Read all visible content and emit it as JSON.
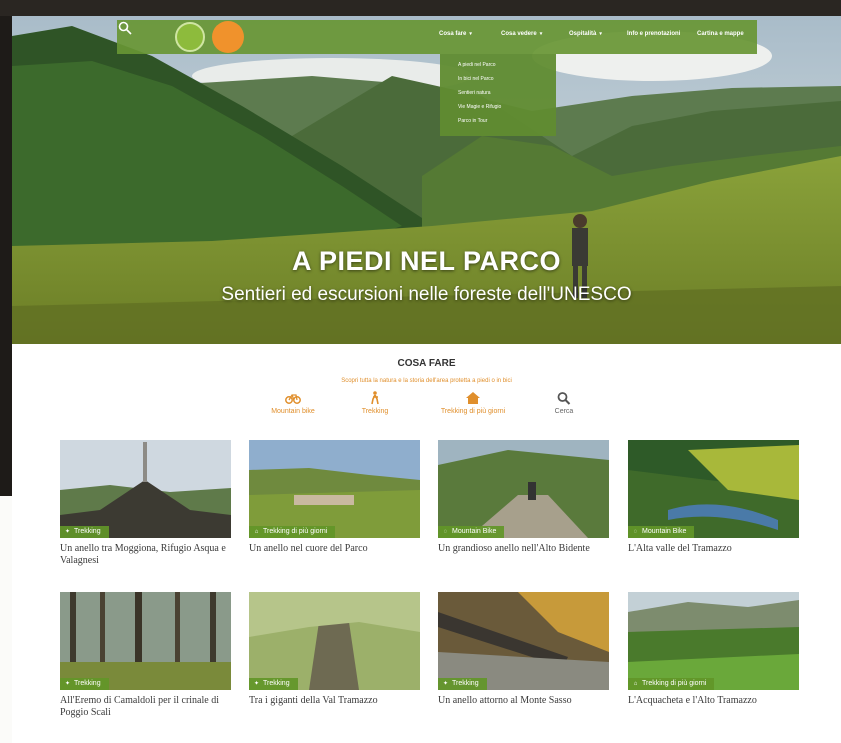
{
  "hero": {
    "title": "A PIEDI NEL PARCO",
    "subtitle": "Sentieri ed escursioni nelle foreste dell'UNESCO"
  },
  "navbar": {
    "search_icon": "search-icon",
    "items": [
      {
        "label": "Cosa fare",
        "caret": "▾"
      },
      {
        "label": "Cosa vedere",
        "caret": "▾"
      },
      {
        "label": "Ospitalità",
        "caret": "▾"
      },
      {
        "label": "Info e prenotazioni",
        "caret": ""
      },
      {
        "label": "Cartina e mappe",
        "caret": ""
      }
    ],
    "dropdown": [
      "A piedi nel Parco",
      "In bici nel Parco",
      "Sentieri natura",
      "Vie Magie e Rifugio",
      "Parco in Tour"
    ]
  },
  "section": {
    "title": "COSA FARE",
    "description": "Scopri tutta la natura e la storia dell'area protetta a piedi o in bici"
  },
  "filters": [
    {
      "label": "Mountain bike",
      "icon": "bike-icon"
    },
    {
      "label": "Trekking",
      "icon": "hiker-icon"
    },
    {
      "label": "Trekking di più giorni",
      "icon": "house-icon"
    },
    {
      "label": "Cerca",
      "icon": "search-icon"
    }
  ],
  "cards": [
    {
      "badge": "Trekking",
      "title": "Un anello tra Moggiona, Rifugio Asqua e Valagnesi"
    },
    {
      "badge": "Trekking di più giorni",
      "title": "Un anello nel cuore del Parco"
    },
    {
      "badge": "Mountain Bike",
      "title": "Un grandioso anello nell'Alto Bidente"
    },
    {
      "badge": "Mountain Bike",
      "title": "L'Alta valle del Tramazzo"
    },
    {
      "badge": "Trekking",
      "title": "All'Eremo di Camaldoli per il crinale di Poggio Scali"
    },
    {
      "badge": "Trekking",
      "title": "Tra i giganti della Val Tramazzo"
    },
    {
      "badge": "Trekking",
      "title": "Un anello attorno al Monte Sasso"
    },
    {
      "badge": "Trekking di più giorni",
      "title": "L'Acquacheta e l'Alto Tramazzo"
    }
  ],
  "colors": {
    "accent": "#e08f2c",
    "nav_green": "#68963a",
    "badge_green": "#62962a"
  }
}
